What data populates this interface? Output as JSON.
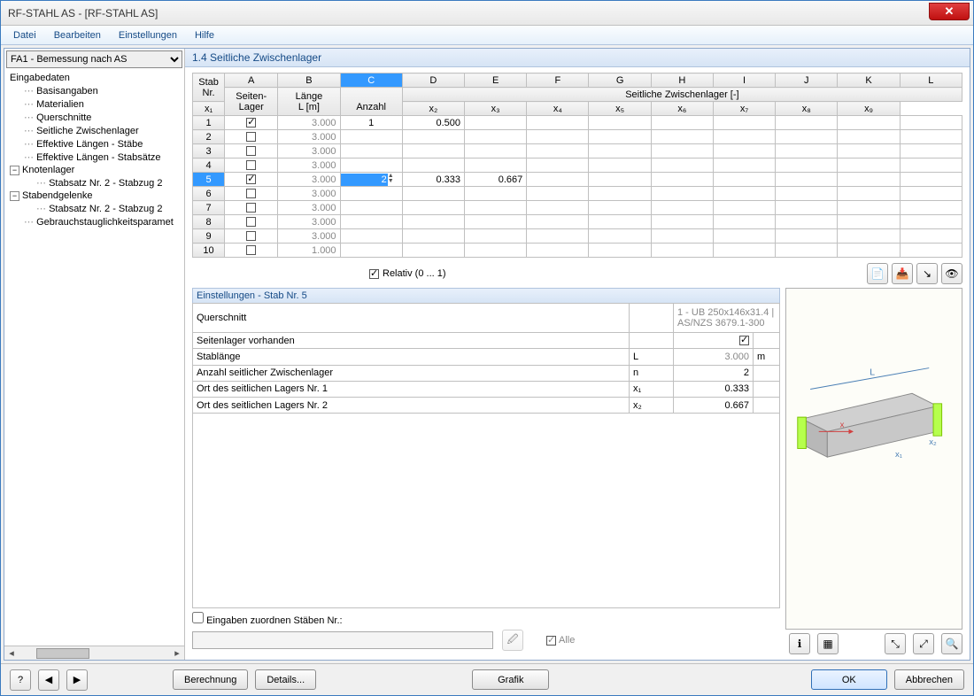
{
  "window": {
    "title": "RF-STAHL AS - [RF-STAHL AS]"
  },
  "menu": {
    "datei": "Datei",
    "bearbeiten": "Bearbeiten",
    "einstellungen": "Einstellungen",
    "hilfe": "Hilfe"
  },
  "sidebar": {
    "dropdown": "FA1 - Bemessung nach AS",
    "root": "Eingabedaten",
    "items": [
      "Basisangaben",
      "Materialien",
      "Querschnitte",
      "Seitliche Zwischenlager",
      "Effektive Längen - Stäbe",
      "Effektive Längen - Stabsätze"
    ],
    "knotenlager": {
      "label": "Knotenlager",
      "child": "Stabsatz Nr. 2 - Stabzug 2"
    },
    "stabendgelenke": {
      "label": "Stabendgelenke",
      "child": "Stabsatz Nr. 2 - Stabzug 2"
    },
    "last": "Gebrauchstauglichkeitsparamet"
  },
  "main": {
    "header": "1.4 Seitliche Zwischenlager"
  },
  "grid": {
    "letters": [
      "A",
      "B",
      "C",
      "D",
      "E",
      "F",
      "G",
      "H",
      "I",
      "J",
      "K",
      "L"
    ],
    "h1": {
      "stab": "Stab",
      "nr": "Nr.",
      "seiten": "Seiten-",
      "lager": "Lager",
      "lange": "Länge",
      "lm": "L [m]",
      "anzahl": "Anzahl",
      "group": "Seitliche Zwischenlager [-]"
    },
    "xlabels": [
      "x₁",
      "x₂",
      "x₃",
      "x₄",
      "x₅",
      "x₆",
      "x₇",
      "x₈",
      "x₉"
    ],
    "rows": [
      {
        "n": "1",
        "chk": true,
        "len": "3.000",
        "anz": "1",
        "x1": "0.500"
      },
      {
        "n": "2",
        "chk": false,
        "len": "3.000"
      },
      {
        "n": "3",
        "chk": false,
        "len": "3.000"
      },
      {
        "n": "4",
        "chk": false,
        "len": "3.000"
      },
      {
        "n": "5",
        "chk": true,
        "len": "3.000",
        "anz_edit": "2",
        "x1": "0.333",
        "x2": "0.667",
        "selected": true
      },
      {
        "n": "6",
        "chk": false,
        "len": "3.000"
      },
      {
        "n": "7",
        "chk": false,
        "len": "3.000"
      },
      {
        "n": "8",
        "chk": false,
        "len": "3.000"
      },
      {
        "n": "9",
        "chk": false,
        "len": "3.000"
      },
      {
        "n": "10",
        "chk": false,
        "len": "1.000"
      }
    ]
  },
  "relativ": {
    "label": "Relativ (0 ... 1)"
  },
  "settings": {
    "title": "Einstellungen - Stab Nr. 5",
    "rows": {
      "querschnitt": {
        "label": "Querschnitt",
        "val": "1 - UB 250x146x31.4 | AS/NZS 3679.1-300"
      },
      "seitenlager": {
        "label": "Seitenlager vorhanden"
      },
      "stablange": {
        "label": "Stablänge",
        "sym": "L",
        "val": "3.000",
        "unit": "m"
      },
      "anzahl": {
        "label": "Anzahl seitlicher Zwischenlager",
        "sym": "n",
        "val": "2"
      },
      "ort1": {
        "label": "Ort des seitlichen Lagers Nr. 1",
        "sym": "x₁",
        "val": "0.333"
      },
      "ort2": {
        "label": "Ort des seitlichen Lagers Nr. 2",
        "sym": "x₂",
        "val": "0.667"
      }
    }
  },
  "assign": {
    "label": "Eingaben zuordnen Stäben Nr.:",
    "alle": "Alle"
  },
  "buttons": {
    "berechnung": "Berechnung",
    "details": "Details...",
    "grafik": "Grafik",
    "ok": "OK",
    "abbrechen": "Abbrechen"
  },
  "preview": {
    "L": "L",
    "x": "x",
    "x1": "x₁",
    "x2": "x₂"
  }
}
